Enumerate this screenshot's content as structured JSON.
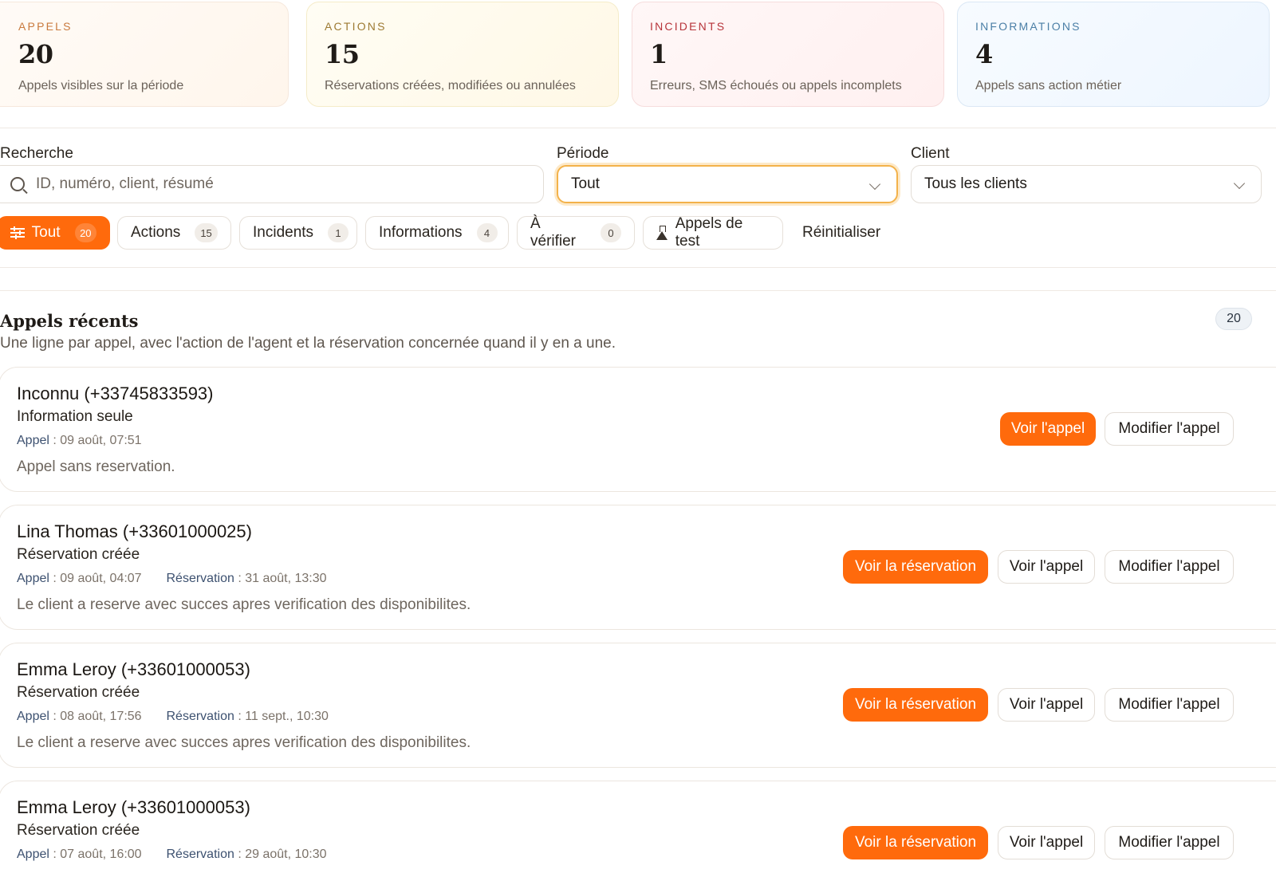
{
  "stats": [
    {
      "label": "APPELS",
      "value": "20",
      "desc": "Appels visibles sur la période"
    },
    {
      "label": "ACTIONS",
      "value": "15",
      "desc": "Réservations créées, modifiées ou annulées"
    },
    {
      "label": "INCIDENTS",
      "value": "1",
      "desc": "Erreurs, SMS échoués ou appels incomplets"
    },
    {
      "label": "INFORMATIONS",
      "value": "4",
      "desc": "Appels sans action métier"
    }
  ],
  "filters": {
    "search_label": "Recherche",
    "search_placeholder": "ID, numéro, client, résumé",
    "period_label": "Période",
    "period_value": "Tout",
    "client_label": "Client",
    "client_value": "Tous les clients",
    "chips": [
      {
        "label": "Tout",
        "count": "20"
      },
      {
        "label": "Actions",
        "count": "15"
      },
      {
        "label": "Incidents",
        "count": "1"
      },
      {
        "label": "Informations",
        "count": "4"
      },
      {
        "label": "À vérifier",
        "count": "0"
      },
      {
        "label": "Appels de test"
      },
      {
        "label": "Réinitialiser"
      }
    ]
  },
  "recent": {
    "title": "Appels récents",
    "subtitle": "Une ligne par appel, avec l'action de l'agent et la réservation concernée quand il y en a une.",
    "count": "20",
    "labels": {
      "appel": "Appel",
      "reservation": "Réservation",
      "view_call": "Voir l'appel",
      "edit_call": "Modifier l'appel",
      "view_res": "Voir la réservation"
    },
    "rows": [
      {
        "name": "Inconnu (+33745833593)",
        "status": "Information seule",
        "call_time": ": 09 août, 07:51",
        "res_time": "",
        "summary": "Appel sans reservation."
      },
      {
        "name": "Lina Thomas (+33601000025)",
        "status": "Réservation créée",
        "call_time": ": 09 août, 04:07",
        "res_time": ": 31 août, 13:30",
        "summary": "Le client a reserve avec succes apres verification des disponibilites."
      },
      {
        "name": "Emma Leroy (+33601000053)",
        "status": "Réservation créée",
        "call_time": ": 08 août, 17:56",
        "res_time": ": 11 sept., 10:30",
        "summary": "Le client a reserve avec succes apres verification des disponibilites."
      },
      {
        "name": "Emma Leroy (+33601000053)",
        "status": "Réservation créée",
        "call_time": ": 07 août, 16:00",
        "res_time": ": 29 août, 10:30",
        "summary": ""
      }
    ]
  },
  "colors": {
    "accent": "#ff6a0c",
    "focus": "#f3b24a"
  }
}
